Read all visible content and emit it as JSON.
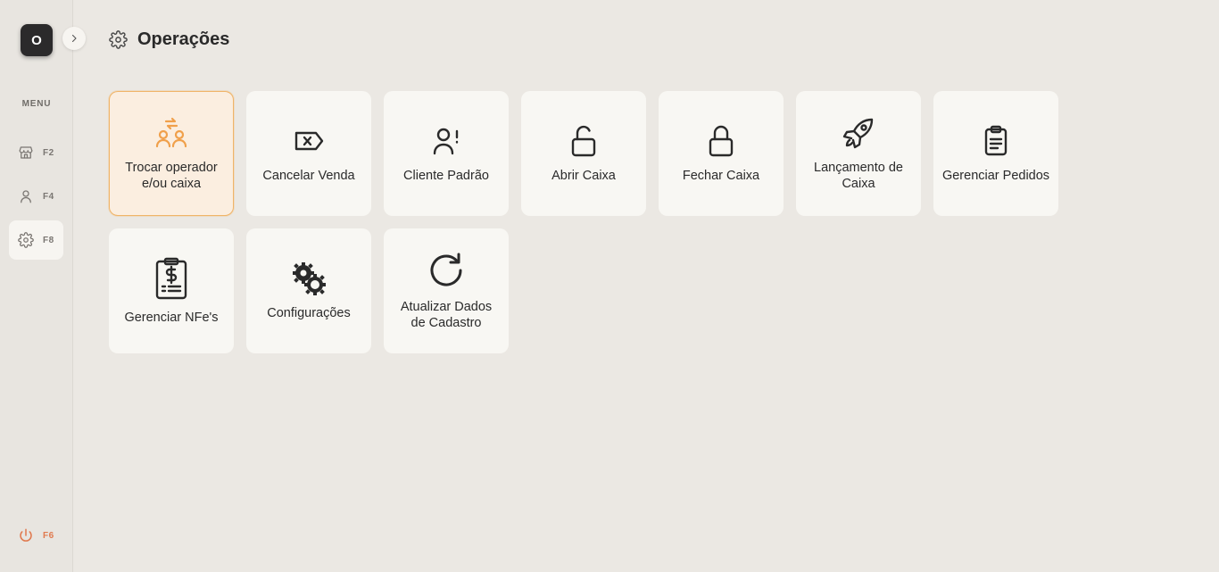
{
  "sidebar": {
    "avatar_initial": "O",
    "menu_label": "MENU",
    "items": [
      {
        "key": "F2",
        "icon": "store-icon"
      },
      {
        "key": "F4",
        "icon": "user-icon"
      },
      {
        "key": "F8",
        "icon": "gear-icon"
      }
    ],
    "power": {
      "key": "F6",
      "icon": "power-icon"
    }
  },
  "header": {
    "title": "Operações",
    "icon": "gear-icon"
  },
  "colors": {
    "accent": "#f0a04b",
    "power": "#e07a4f",
    "card_bg": "#f8f7f3",
    "page_bg": "#ebe8e3"
  },
  "cards": [
    {
      "label": "Trocar operador e/ou caixa",
      "icon": "swap-users-icon",
      "selected": true
    },
    {
      "label": "Cancelar Venda",
      "icon": "cancel-tag-icon"
    },
    {
      "label": "Cliente Padrão",
      "icon": "user-alert-icon"
    },
    {
      "label": "Abrir Caixa",
      "icon": "unlock-icon"
    },
    {
      "label": "Fechar Caixa",
      "icon": "lock-icon"
    },
    {
      "label": "Lançamento de Caixa",
      "icon": "rocket-icon"
    },
    {
      "label": "Gerenciar Pedidos",
      "icon": "clipboard-icon"
    },
    {
      "label": "Gerenciar NFe's",
      "icon": "invoice-dollar-icon"
    },
    {
      "label": "Configurações",
      "icon": "gears-icon"
    },
    {
      "label": "Atualizar Dados de Cadastro",
      "icon": "refresh-icon"
    }
  ]
}
